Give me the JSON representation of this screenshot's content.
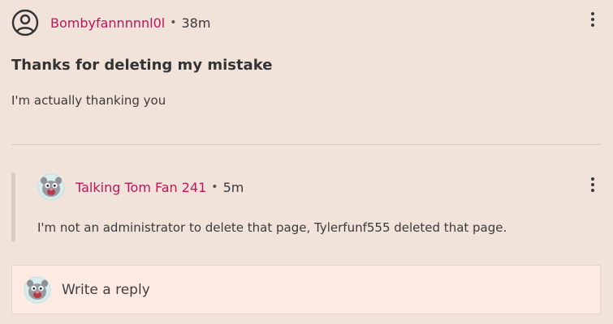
{
  "post": {
    "author": "Bombyfannnnnl0l",
    "separator": "•",
    "time": "38m",
    "title": "Thanks for deleting my mistake",
    "body": "I'm actually thanking you",
    "author_icon": "user-circle-icon"
  },
  "reply": {
    "author": "Talking Tom Fan 241",
    "separator": "•",
    "time": "5m",
    "text": "I'm not an administrator to delete that page, Tylerfunf555 deleted that page.",
    "avatar_icon": "talking-tom-avatar"
  },
  "reply_input": {
    "placeholder": "Write a reply",
    "avatar_icon": "talking-tom-avatar"
  },
  "colors": {
    "background": "#f2e3da",
    "username": "#c0145a",
    "reply_box": "#fdebe3"
  }
}
